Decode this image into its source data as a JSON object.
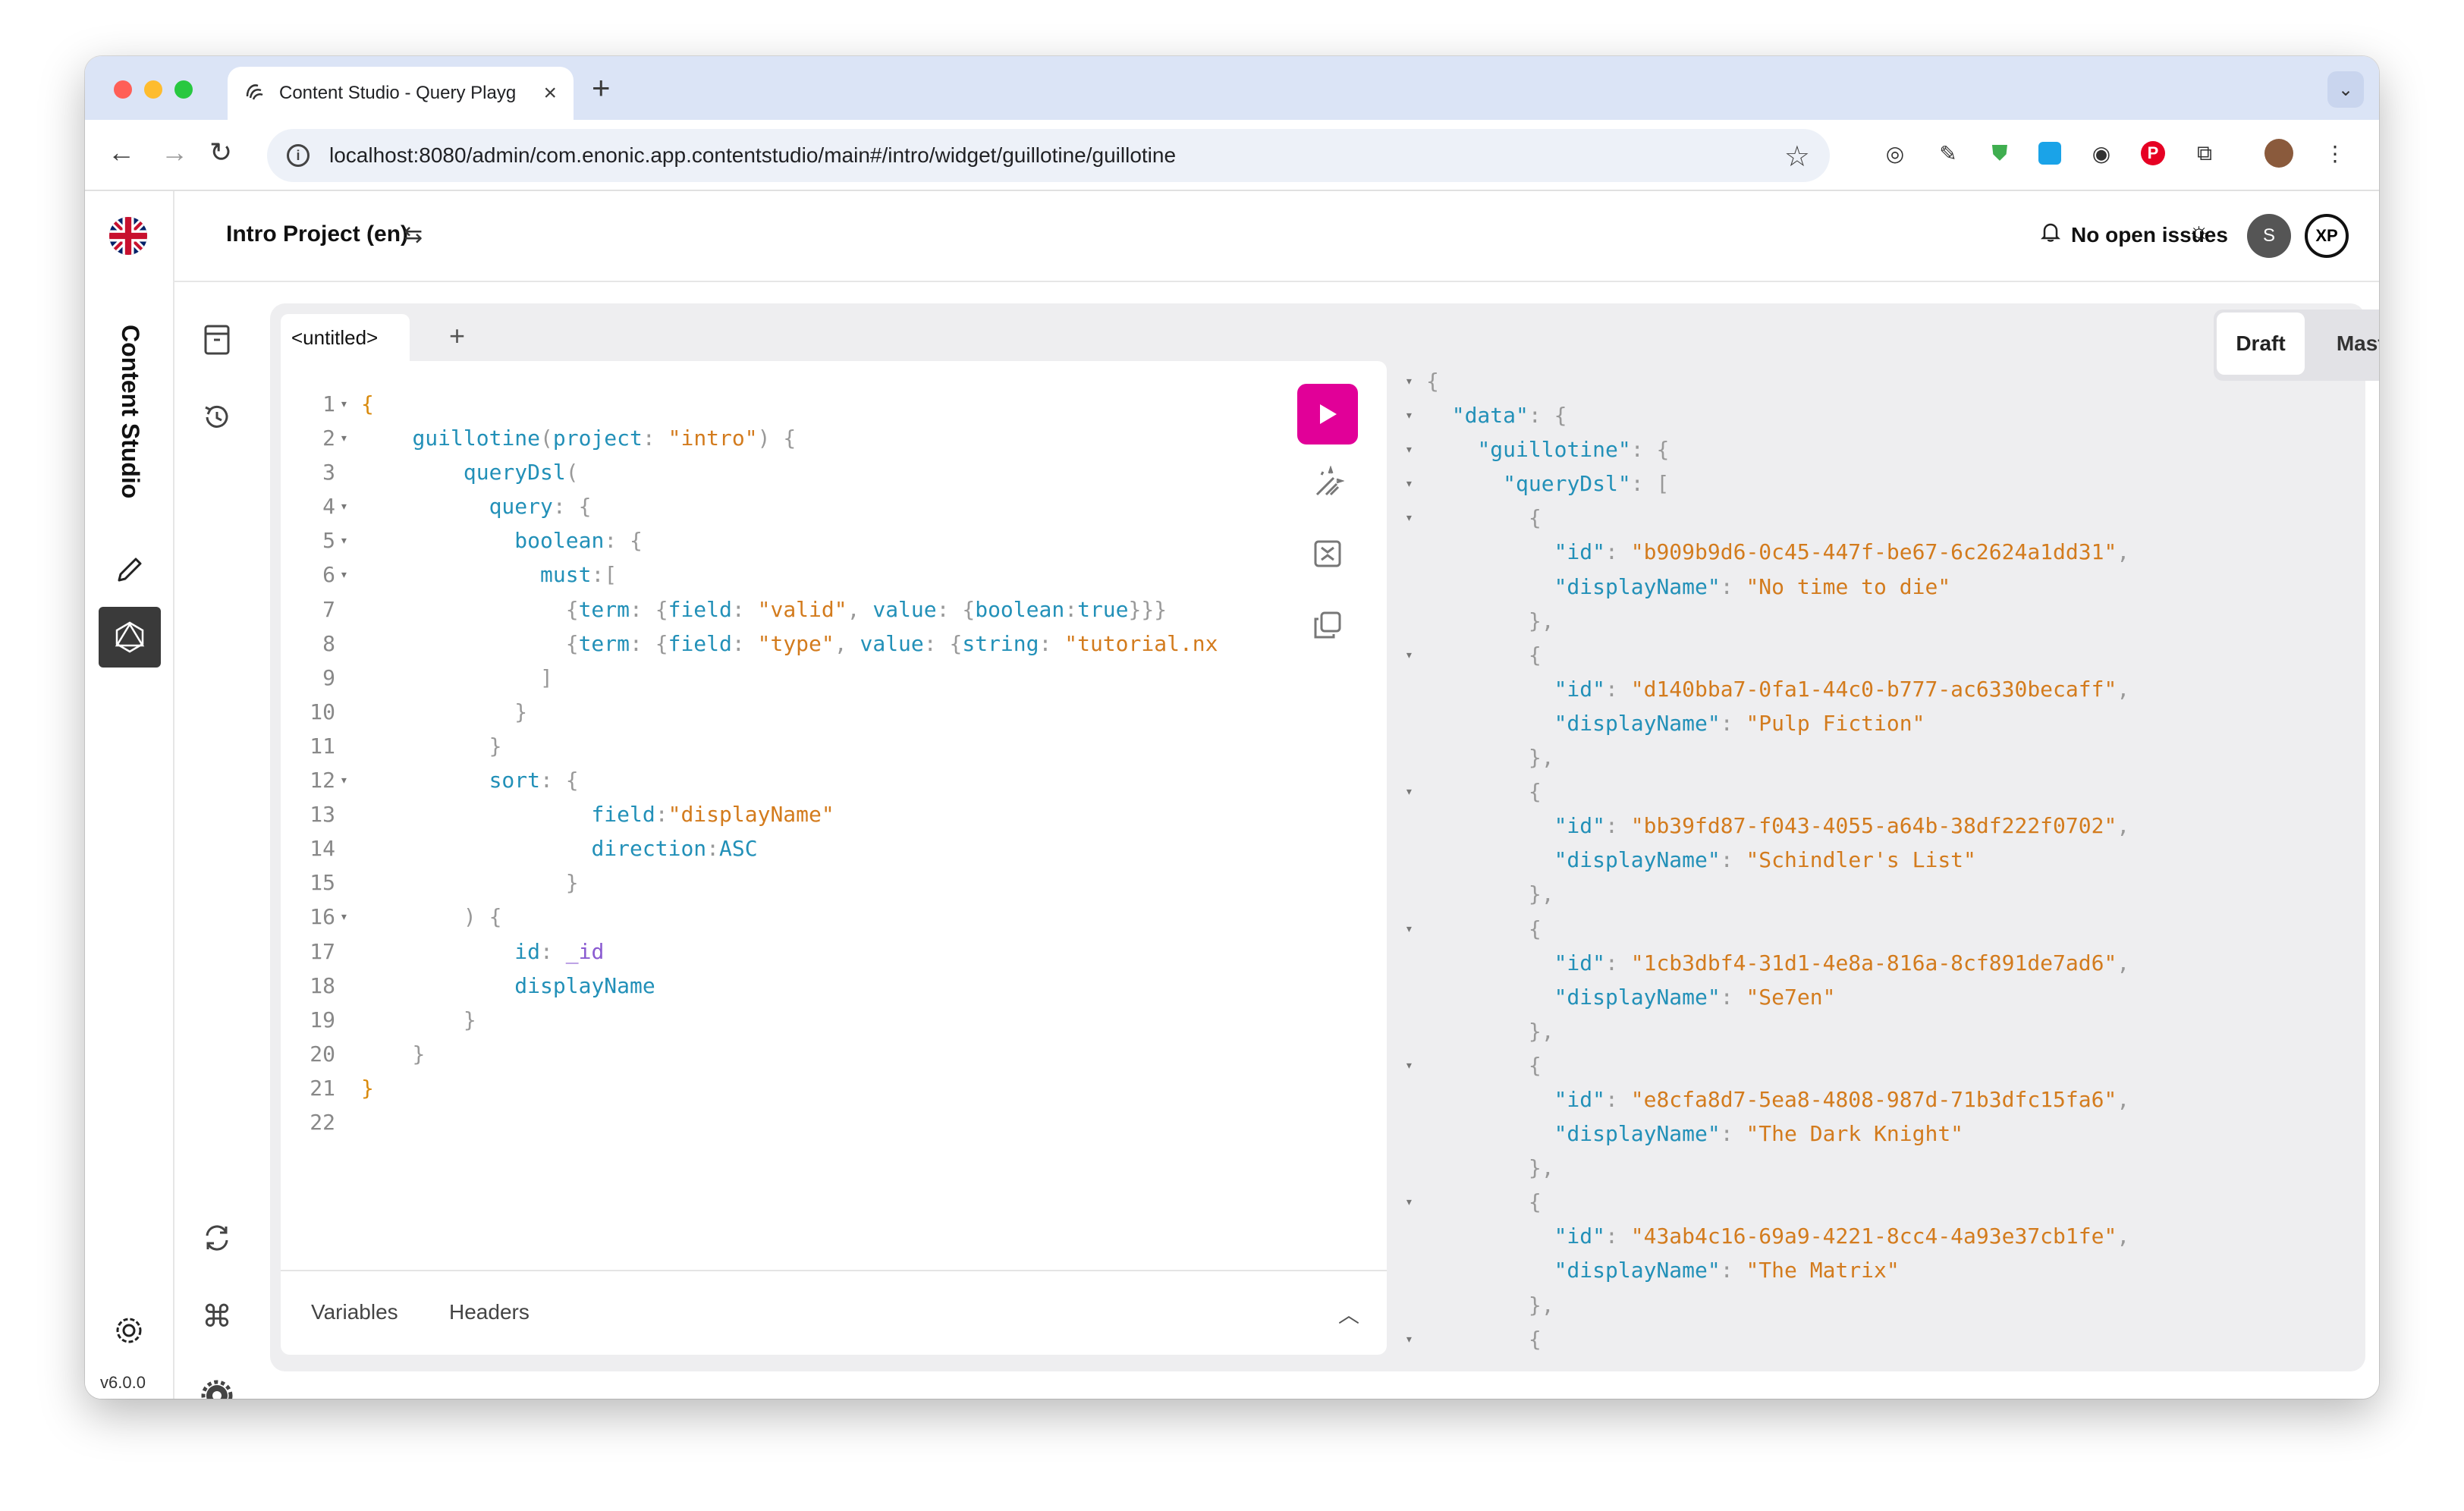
{
  "browser": {
    "tab_title": "Content Studio - Query Playg",
    "url": "localhost:8080/admin/com.enonic.app.contentstudio/main#/intro/widget/guillotine/guillotine"
  },
  "app": {
    "brand": "Content Studio",
    "project": "Intro Project (en)",
    "issues": "No open issues",
    "avatar_initial": "S",
    "xp_logo": "XP",
    "version": "v6.0.0"
  },
  "playground": {
    "editor_tab": "<untitled>",
    "footer_tabs": [
      "Variables",
      "Headers"
    ],
    "env": {
      "draft": "Draft",
      "master": "Master",
      "active": "Draft"
    }
  },
  "query_lines": [
    "{",
    "    guillotine(project: \"intro\") {",
    "        queryDsl(",
    "          query: {",
    "            boolean: {",
    "              must:[",
    "                {term: {field: \"valid\", value: {boolean:true}}}",
    "                {term: {field: \"type\", value: {string: \"tutorial.nx",
    "              ]",
    "            }",
    "          }",
    "          sort: {",
    "                  field:\"displayName\"",
    "                  direction:ASC",
    "                }",
    "        ) {",
    "            id: _id",
    "            displayName",
    "        }",
    "    }",
    "}",
    ""
  ],
  "query_folds": [
    1,
    2,
    4,
    5,
    6,
    12,
    16
  ],
  "results": [
    {
      "id": "b909b9d6-0c45-447f-be67-6c2624a1dd31",
      "displayName": "No time to die"
    },
    {
      "id": "d140bba7-0fa1-44c0-b777-ac6330becaff",
      "displayName": "Pulp Fiction"
    },
    {
      "id": "bb39fd87-f043-4055-a64b-38df222f0702",
      "displayName": "Schindler's List"
    },
    {
      "id": "1cb3dbf4-31d1-4e8a-816a-8cf891de7ad6",
      "displayName": "Se7en"
    },
    {
      "id": "e8cfa8d7-5ea8-4808-987d-71b3dfc15fa6",
      "displayName": "The Dark Knight"
    },
    {
      "id": "43ab4c16-69a9-4221-8cc4-4a93e37cb1fe",
      "displayName": "The Matrix"
    }
  ],
  "result_keys": {
    "data": "data",
    "guillotine": "guillotine",
    "queryDsl": "queryDsl",
    "id": "id",
    "displayName": "displayName"
  },
  "colors": {
    "run": "#e10098",
    "key": "#2290b8",
    "string": "#d37b1d"
  },
  "icons": [
    "flag-icon",
    "archive-icon",
    "history-icon",
    "pencil-icon",
    "graphql-icon",
    "refresh-icon",
    "command-icon",
    "settings-icon",
    "bell-icon",
    "theme-icon",
    "play-icon",
    "prettify-icon",
    "merge-icon",
    "copy-icon"
  ]
}
